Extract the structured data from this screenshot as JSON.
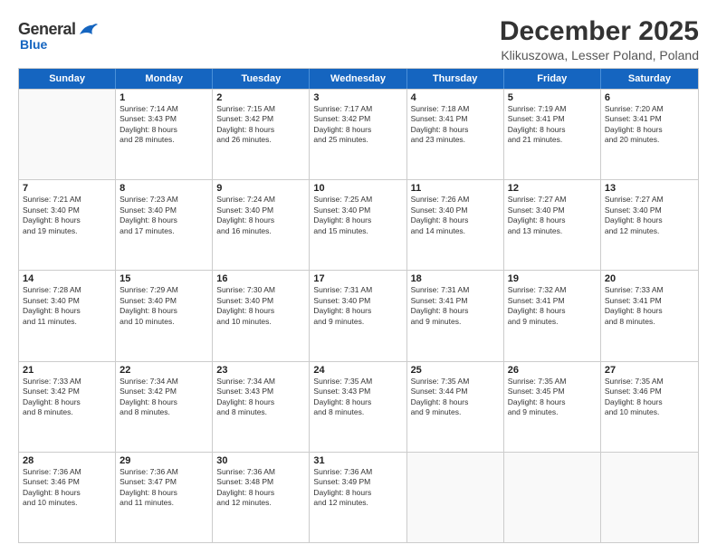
{
  "logo": {
    "general": "General",
    "blue": "Blue"
  },
  "title": {
    "month": "December 2025",
    "location": "Klikuszowa, Lesser Poland, Poland"
  },
  "days": [
    "Sunday",
    "Monday",
    "Tuesday",
    "Wednesday",
    "Thursday",
    "Friday",
    "Saturday"
  ],
  "weeks": [
    [
      {
        "day": "",
        "info": ""
      },
      {
        "day": "1",
        "info": "Sunrise: 7:14 AM\nSunset: 3:43 PM\nDaylight: 8 hours\nand 28 minutes."
      },
      {
        "day": "2",
        "info": "Sunrise: 7:15 AM\nSunset: 3:42 PM\nDaylight: 8 hours\nand 26 minutes."
      },
      {
        "day": "3",
        "info": "Sunrise: 7:17 AM\nSunset: 3:42 PM\nDaylight: 8 hours\nand 25 minutes."
      },
      {
        "day": "4",
        "info": "Sunrise: 7:18 AM\nSunset: 3:41 PM\nDaylight: 8 hours\nand 23 minutes."
      },
      {
        "day": "5",
        "info": "Sunrise: 7:19 AM\nSunset: 3:41 PM\nDaylight: 8 hours\nand 21 minutes."
      },
      {
        "day": "6",
        "info": "Sunrise: 7:20 AM\nSunset: 3:41 PM\nDaylight: 8 hours\nand 20 minutes."
      }
    ],
    [
      {
        "day": "7",
        "info": "Sunrise: 7:21 AM\nSunset: 3:40 PM\nDaylight: 8 hours\nand 19 minutes."
      },
      {
        "day": "8",
        "info": "Sunrise: 7:23 AM\nSunset: 3:40 PM\nDaylight: 8 hours\nand 17 minutes."
      },
      {
        "day": "9",
        "info": "Sunrise: 7:24 AM\nSunset: 3:40 PM\nDaylight: 8 hours\nand 16 minutes."
      },
      {
        "day": "10",
        "info": "Sunrise: 7:25 AM\nSunset: 3:40 PM\nDaylight: 8 hours\nand 15 minutes."
      },
      {
        "day": "11",
        "info": "Sunrise: 7:26 AM\nSunset: 3:40 PM\nDaylight: 8 hours\nand 14 minutes."
      },
      {
        "day": "12",
        "info": "Sunrise: 7:27 AM\nSunset: 3:40 PM\nDaylight: 8 hours\nand 13 minutes."
      },
      {
        "day": "13",
        "info": "Sunrise: 7:27 AM\nSunset: 3:40 PM\nDaylight: 8 hours\nand 12 minutes."
      }
    ],
    [
      {
        "day": "14",
        "info": "Sunrise: 7:28 AM\nSunset: 3:40 PM\nDaylight: 8 hours\nand 11 minutes."
      },
      {
        "day": "15",
        "info": "Sunrise: 7:29 AM\nSunset: 3:40 PM\nDaylight: 8 hours\nand 10 minutes."
      },
      {
        "day": "16",
        "info": "Sunrise: 7:30 AM\nSunset: 3:40 PM\nDaylight: 8 hours\nand 10 minutes."
      },
      {
        "day": "17",
        "info": "Sunrise: 7:31 AM\nSunset: 3:40 PM\nDaylight: 8 hours\nand 9 minutes."
      },
      {
        "day": "18",
        "info": "Sunrise: 7:31 AM\nSunset: 3:41 PM\nDaylight: 8 hours\nand 9 minutes."
      },
      {
        "day": "19",
        "info": "Sunrise: 7:32 AM\nSunset: 3:41 PM\nDaylight: 8 hours\nand 9 minutes."
      },
      {
        "day": "20",
        "info": "Sunrise: 7:33 AM\nSunset: 3:41 PM\nDaylight: 8 hours\nand 8 minutes."
      }
    ],
    [
      {
        "day": "21",
        "info": "Sunrise: 7:33 AM\nSunset: 3:42 PM\nDaylight: 8 hours\nand 8 minutes."
      },
      {
        "day": "22",
        "info": "Sunrise: 7:34 AM\nSunset: 3:42 PM\nDaylight: 8 hours\nand 8 minutes."
      },
      {
        "day": "23",
        "info": "Sunrise: 7:34 AM\nSunset: 3:43 PM\nDaylight: 8 hours\nand 8 minutes."
      },
      {
        "day": "24",
        "info": "Sunrise: 7:35 AM\nSunset: 3:43 PM\nDaylight: 8 hours\nand 8 minutes."
      },
      {
        "day": "25",
        "info": "Sunrise: 7:35 AM\nSunset: 3:44 PM\nDaylight: 8 hours\nand 9 minutes."
      },
      {
        "day": "26",
        "info": "Sunrise: 7:35 AM\nSunset: 3:45 PM\nDaylight: 8 hours\nand 9 minutes."
      },
      {
        "day": "27",
        "info": "Sunrise: 7:35 AM\nSunset: 3:46 PM\nDaylight: 8 hours\nand 10 minutes."
      }
    ],
    [
      {
        "day": "28",
        "info": "Sunrise: 7:36 AM\nSunset: 3:46 PM\nDaylight: 8 hours\nand 10 minutes."
      },
      {
        "day": "29",
        "info": "Sunrise: 7:36 AM\nSunset: 3:47 PM\nDaylight: 8 hours\nand 11 minutes."
      },
      {
        "day": "30",
        "info": "Sunrise: 7:36 AM\nSunset: 3:48 PM\nDaylight: 8 hours\nand 12 minutes."
      },
      {
        "day": "31",
        "info": "Sunrise: 7:36 AM\nSunset: 3:49 PM\nDaylight: 8 hours\nand 12 minutes."
      },
      {
        "day": "",
        "info": ""
      },
      {
        "day": "",
        "info": ""
      },
      {
        "day": "",
        "info": ""
      }
    ]
  ]
}
